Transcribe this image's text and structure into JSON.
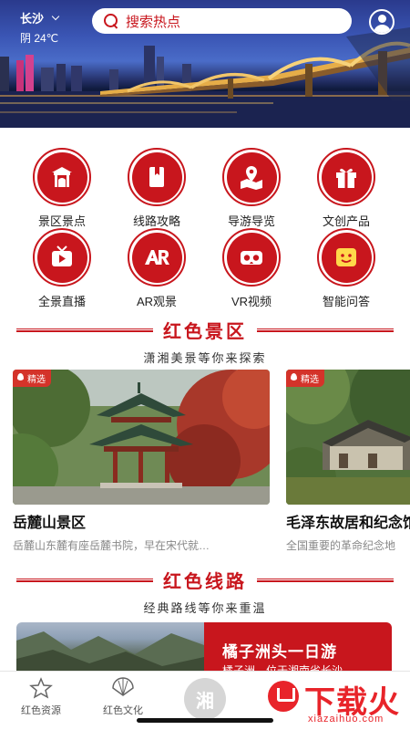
{
  "header": {
    "city": "长沙",
    "weather": "阴 24℃",
    "search_placeholder": "搜索热点"
  },
  "categories": [
    {
      "label": "景区景点",
      "icon": "scenic-gate-icon"
    },
    {
      "label": "线路攻略",
      "icon": "guide-book-icon"
    },
    {
      "label": "导游导览",
      "icon": "map-pin-icon"
    },
    {
      "label": "文创产品",
      "icon": "gift-box-icon"
    },
    {
      "label": "全景直播",
      "icon": "live-tv-icon"
    },
    {
      "label": "AR观景",
      "icon": "ar-icon"
    },
    {
      "label": "VR视频",
      "icon": "vr-goggles-icon"
    },
    {
      "label": "智能问答",
      "icon": "robot-face-icon"
    }
  ],
  "section_scenic": {
    "title": "红色景区",
    "subtitle": "潇湘美景等你来探索"
  },
  "scenic_cards": [
    {
      "badge": "精选",
      "name": "岳麓山景区",
      "desc": "岳麓山东麓有座岳麓书院，早在宋代就…"
    },
    {
      "badge": "精选",
      "name": "毛泽东故居和纪念馆",
      "desc": "全国重要的革命纪念地"
    }
  ],
  "section_routes": {
    "title": "红色线路",
    "subtitle": "经典路线等你来重温"
  },
  "route_banner": {
    "title": "橘子洲头一日游",
    "desc": "橘子洲，位于湘南省长沙"
  },
  "tabbar": {
    "tabs": [
      {
        "label": "红色资源",
        "icon": "star-icon"
      },
      {
        "label": "红色文化",
        "icon": "fan-icon"
      }
    ],
    "center_label": "湘"
  },
  "watermark": {
    "text": "下载火",
    "sub": "xiazaihuo.com"
  },
  "colors": {
    "brand_red": "#c8161d"
  }
}
